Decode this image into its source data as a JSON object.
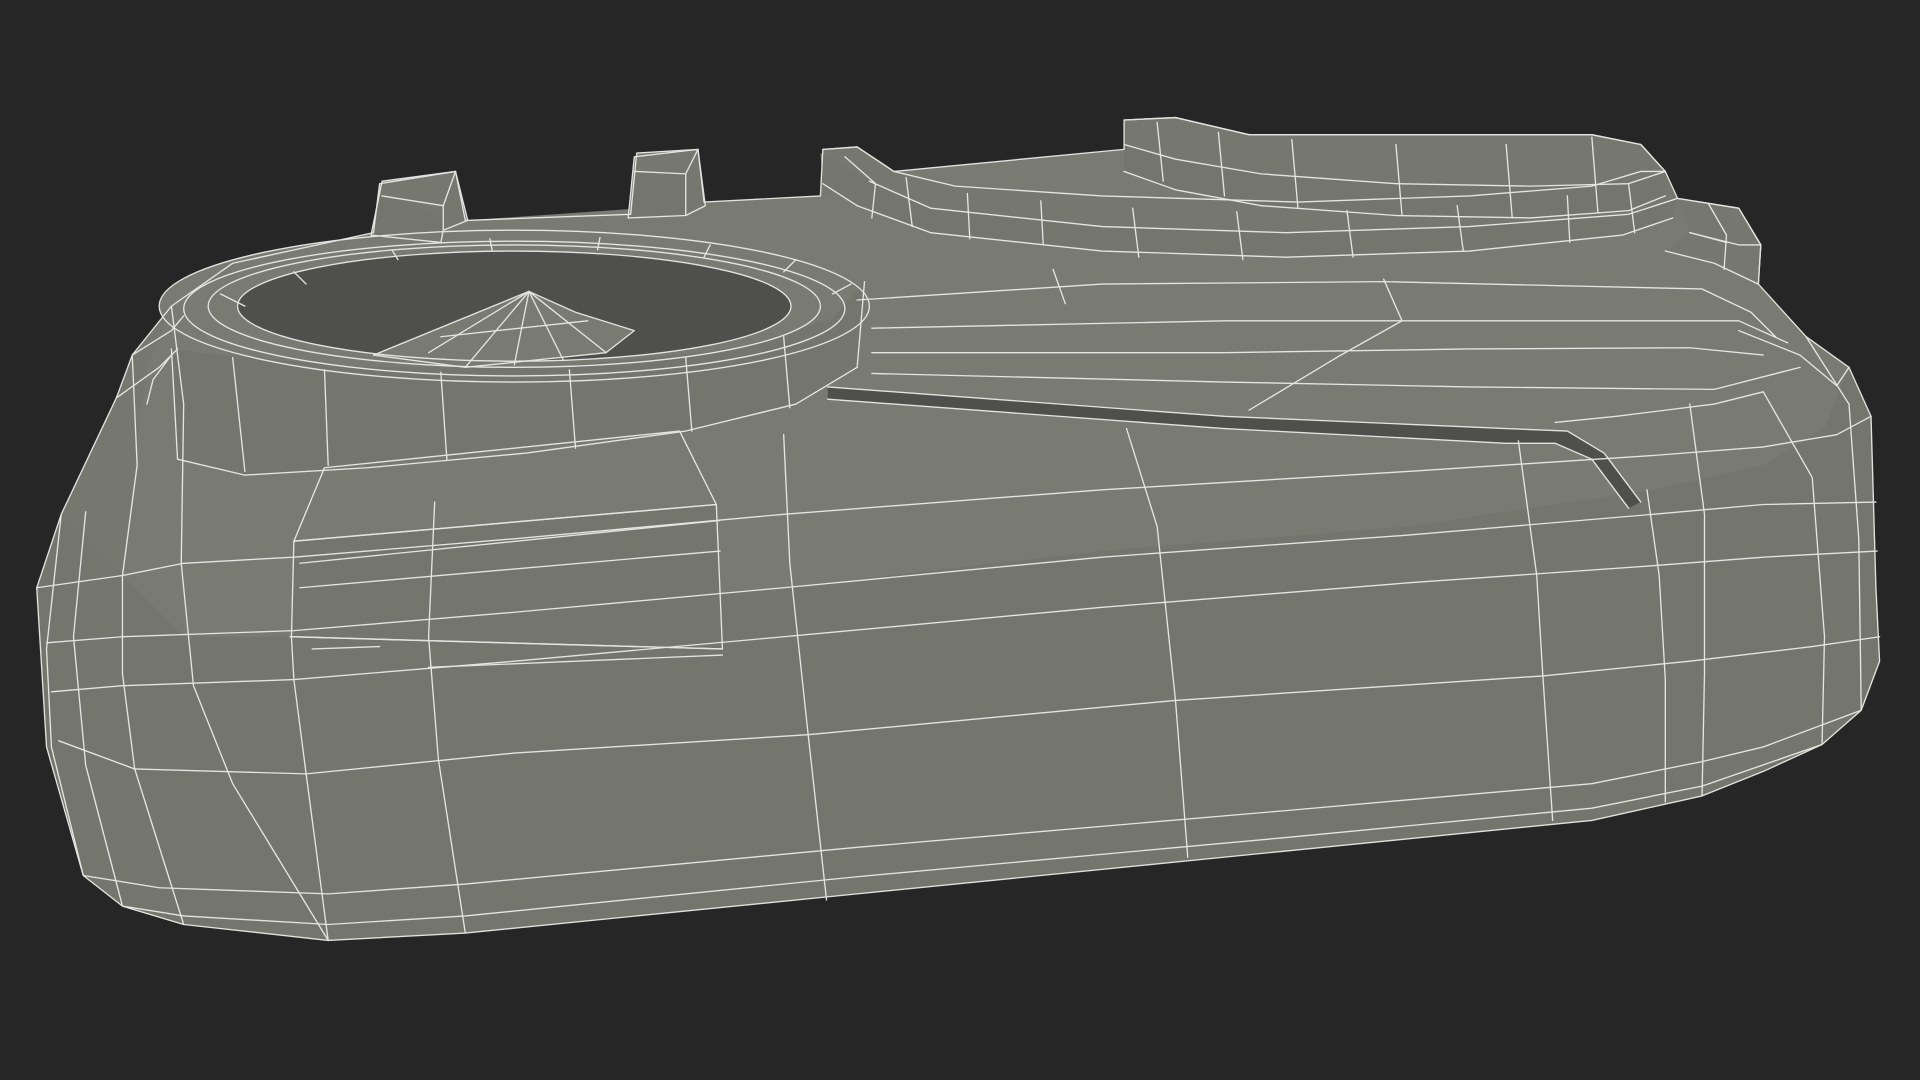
{
  "render": {
    "background_color": "#262626",
    "surface_color": "#76776f",
    "surface_shadow_color": "#6a6b64",
    "inner_shadow_color": "#4f504b",
    "wire_color": "#eeeeea"
  }
}
